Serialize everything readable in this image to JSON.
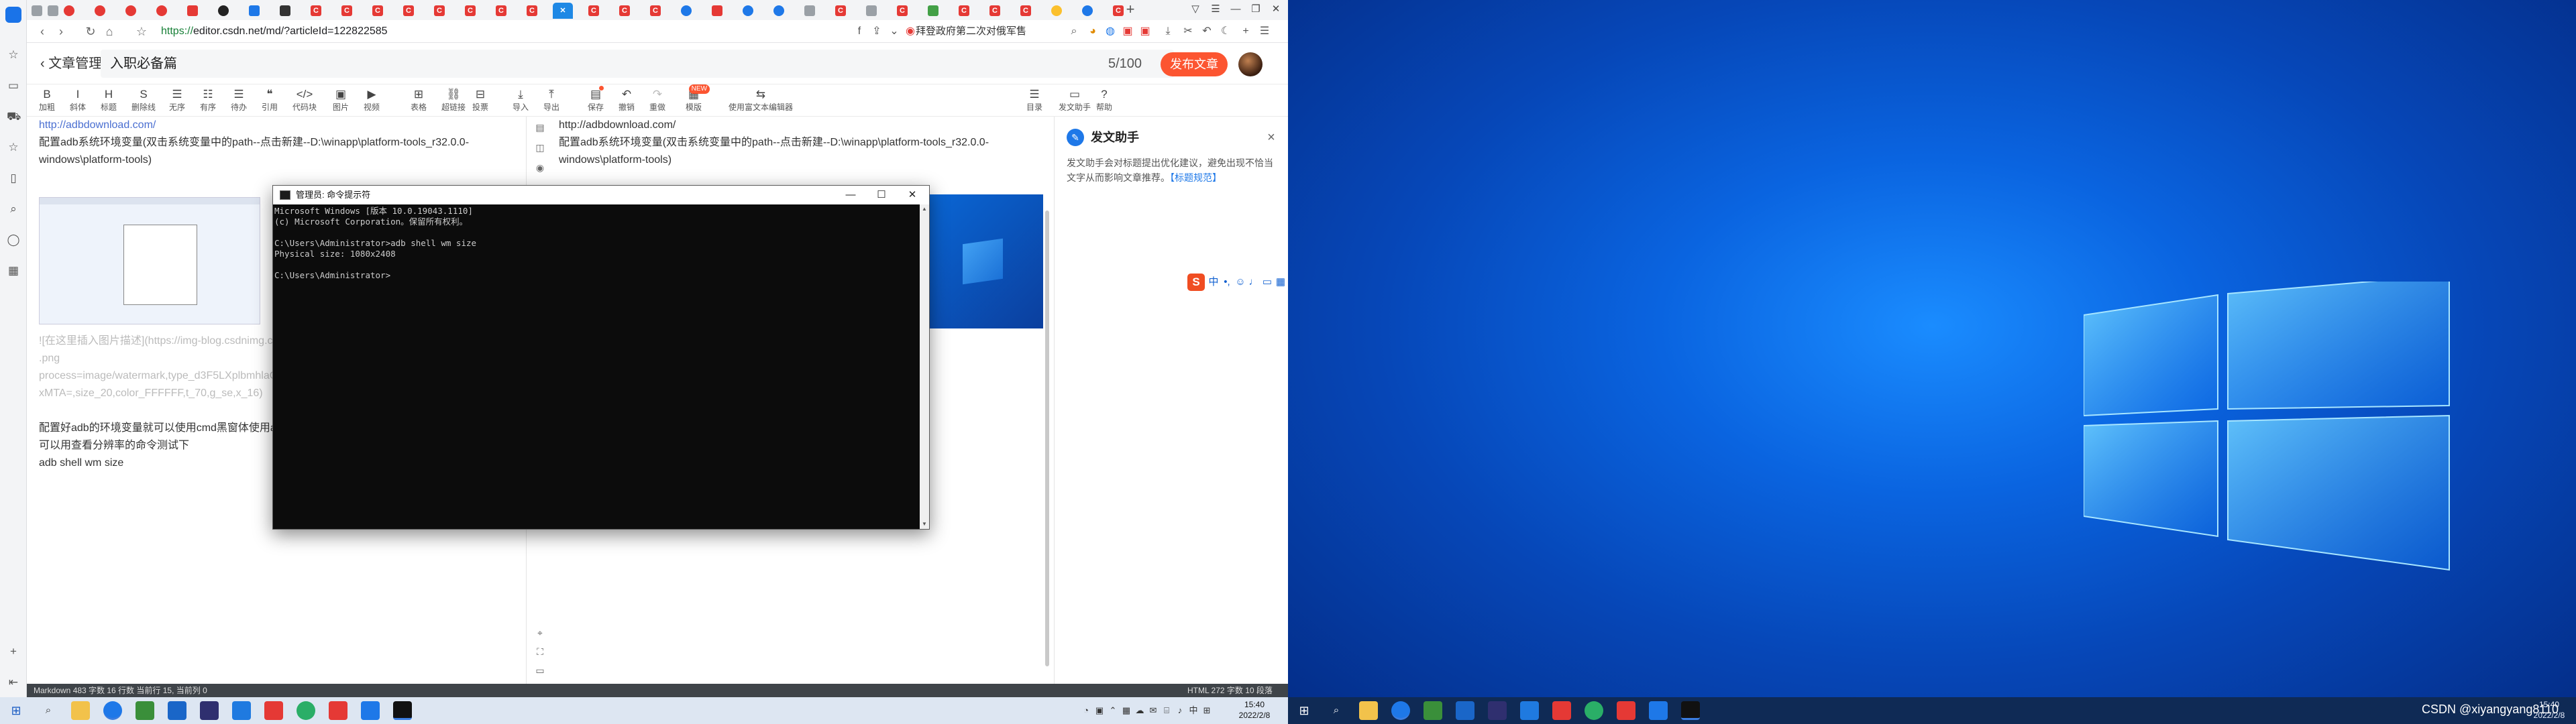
{
  "browser": {
    "url_scheme": "https://",
    "url_rest": "editor.csdn.net/md/?articleId=122822585",
    "news_ticker": "拜登政府第二次对俄军售",
    "accent": "#fc5531"
  },
  "editor": {
    "back_label": "文章管理",
    "title_value": "入职必备篇",
    "title_count": "5/100",
    "publish_label": "发布文章",
    "toolbar": [
      {
        "name": "bold",
        "icon": "B",
        "label": "加粗"
      },
      {
        "name": "italic",
        "icon": "I",
        "label": "斜体"
      },
      {
        "name": "heading",
        "icon": "H",
        "label": "标题"
      },
      {
        "name": "strike",
        "icon": "S",
        "label": "删除线"
      },
      {
        "name": "unordered",
        "icon": "☰",
        "label": "无序"
      },
      {
        "name": "ordered",
        "icon": "☷",
        "label": "有序"
      },
      {
        "name": "todo",
        "icon": "☰",
        "label": "待办"
      },
      {
        "name": "quote",
        "icon": "❝",
        "label": "引用"
      },
      {
        "name": "codeblock",
        "icon": "</>",
        "label": "代码块"
      },
      {
        "name": "image",
        "icon": "▣",
        "label": "图片"
      },
      {
        "name": "video",
        "icon": "▶",
        "label": "视频"
      },
      {
        "name": "table",
        "icon": "⊞",
        "label": "表格"
      },
      {
        "name": "link",
        "icon": "⛓",
        "label": "超链接"
      },
      {
        "name": "vote",
        "icon": "⊟",
        "label": "投票"
      },
      {
        "name": "import",
        "icon": "⤓",
        "label": "导入"
      },
      {
        "name": "export",
        "icon": "⤒",
        "label": "导出"
      },
      {
        "name": "save",
        "icon": "▤",
        "label": "保存"
      },
      {
        "name": "undo",
        "icon": "↶",
        "label": "撤销"
      },
      {
        "name": "redo",
        "icon": "↷",
        "label": "重做"
      },
      {
        "name": "template",
        "icon": "▦",
        "label": "模版"
      },
      {
        "name": "richtext",
        "icon": "⇆",
        "label": "使用富文本编辑器"
      },
      {
        "name": "toc",
        "icon": "☰",
        "label": "目录"
      },
      {
        "name": "assistant",
        "icon": "▭",
        "label": "发文助手"
      },
      {
        "name": "help",
        "icon": "?",
        "label": "帮助"
      }
    ],
    "template_badge": "NEW",
    "left_lines": [
      "http://adbdownload.com/",
      "配置adb系统环境变量(双击系统变量中的path--点击新建--D:\\winapp\\platform-tools_r32.0.0-",
      "windows\\platform-tools)"
    ],
    "left_faint": [
      "![在这里插入图片描述](https://img-blog.csdnimg.cn/",
      ".png",
      "process=image/watermark,type_d3F5LXplbmhlaQ",
      "xMTA=,size_20,color_FFFFFF,t_70,g_se,x_16)"
    ],
    "left_after": [
      "配置好adb的环境变量就可以使用cmd黑窗体使用a",
      "可以用查看分辨率的命令测试下",
      "adb shell wm size"
    ],
    "right_lines": [
      "http://adbdownload.com/",
      "配置adb系统环境变量(双击系统变量中的path--点击新建--D:\\winapp\\platform-tools_r32.0.0-",
      "windows\\platform-tools)"
    ],
    "status_left": "Markdown  483 字数  16 行数  当前行 15, 当前列 0",
    "status_right": "HTML  272 字数  10 段落"
  },
  "help": {
    "title": "发文助手",
    "desc": "发文助手会对标题提出优化建议，避免出现不恰当文字从而影响文章推荐。",
    "link": "【标题规范】"
  },
  "cmd": {
    "title": "管理员: 命令提示符",
    "lines": [
      "Microsoft Windows [版本 10.0.19043.1110]",
      "(c) Microsoft Corporation。保留所有权利。",
      "",
      "C:\\Users\\Administrator>adb shell wm size",
      "Physical size: 1080x2408",
      "",
      "C:\\Users\\Administrator>"
    ]
  },
  "taskbar": {
    "left_time": "15:40",
    "left_date": "2022/2/8",
    "right_time": "15:40",
    "right_date": "2022/2/8",
    "ime": "中"
  },
  "watermark": "CSDN @xiyangyang8110"
}
